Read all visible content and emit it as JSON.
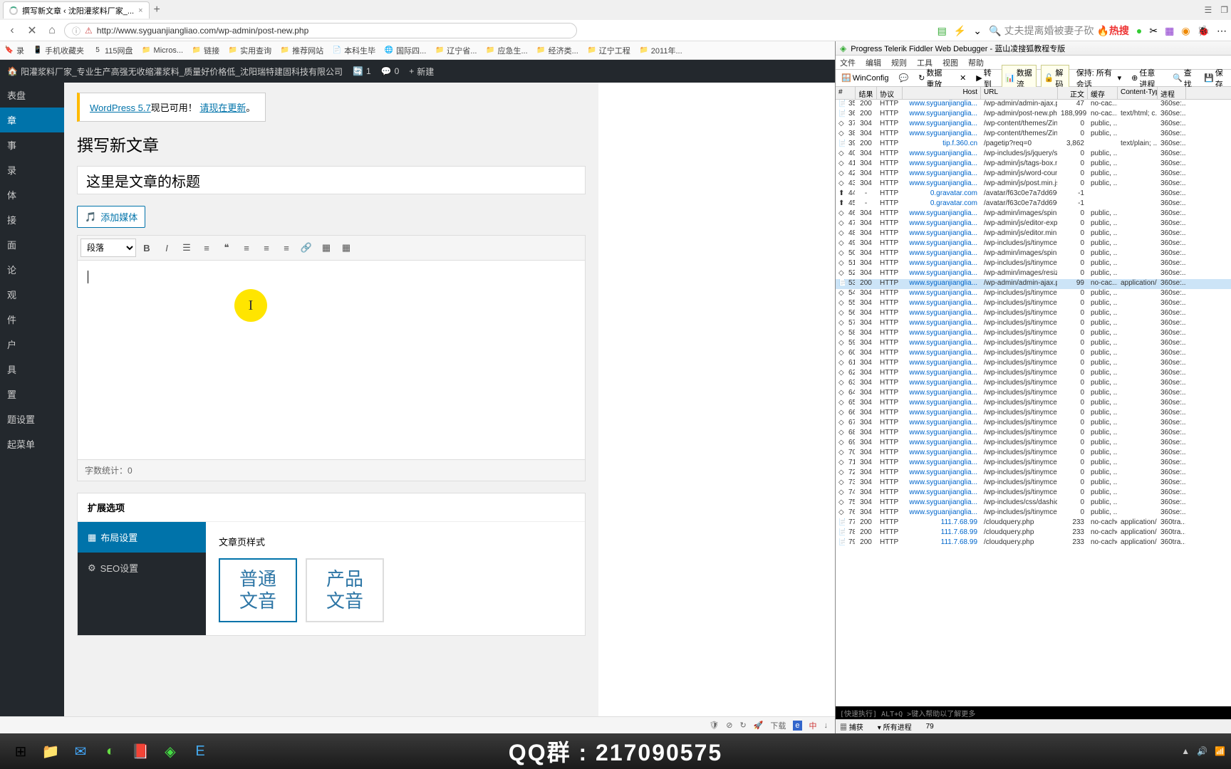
{
  "browser": {
    "tab_title": "撰写新文章 ‹ 沈阳灌浆料厂家_...",
    "url": "http://www.syguanjiangliao.com/wp-admin/post-new.php",
    "search_placeholder": "丈夫提离婚被妻子砍",
    "hot_label": "🔥热搜"
  },
  "bookmarks": [
    "录",
    "手机收藏夹",
    "115网盘",
    "Micros...",
    "链接",
    "实用查询",
    "推荐网站",
    "本科生毕",
    "国际四...",
    "辽宁省...",
    "应急生...",
    "经济类...",
    "辽宁工程",
    "2011年..."
  ],
  "wp_adminbar": {
    "site": "阳灌浆料厂家_专业生产高强无收缩灌浆料_质量好价格低_沈阳瑞特建固科技有限公司",
    "comments_pending": "1",
    "comments_new": "0",
    "new_label": "新建"
  },
  "wp_sidebar": [
    "表盘",
    "章",
    "事",
    "录",
    "体",
    "接",
    "面",
    "论",
    "观",
    "件",
    "户",
    "具",
    "置",
    "题设置",
    "起菜单"
  ],
  "editor": {
    "notice_pre": "WordPress 5.7",
    "notice_mid": "现已可用！",
    "notice_link": "请现在更新",
    "page_heading": "撰写新文章",
    "title_value": "这里是文章的标题",
    "media_btn": "添加媒体",
    "format_select": "段落",
    "word_count_label": "字数统计：",
    "word_count_value": "0",
    "ext_header": "扩展选项",
    "ext_tab_layout": "布局设置",
    "ext_tab_seo": "SEO设置",
    "ext_content_heading": "文章页样式",
    "style_card_1": "普通\n文音",
    "style_card_2": "产品\n文音"
  },
  "fiddler": {
    "title": "Progress Telerik Fiddler Web Debugger - 蓝山凌搜狐教程专版",
    "menus": [
      "文件",
      "编辑",
      "规则",
      "工具",
      "视图",
      "帮助"
    ],
    "toolbar": {
      "winconfig": "WinConfig",
      "replay": "数据重放",
      "go": "转到",
      "stream": "数据流",
      "decode": "解码",
      "keep": "保持: 所有会话",
      "process": "任意进程",
      "find": "查找",
      "save": "保存"
    },
    "headers": {
      "num": "#",
      "result": "结果",
      "protocol": "协议",
      "host": "Host",
      "url": "URL",
      "body": "正文",
      "cache": "缓存",
      "ct": "Content-Type",
      "process": "进程"
    },
    "cmd": "[快速执行] ALT+Q >键入帮助以了解更多",
    "status": {
      "capture": "捕获",
      "all": "所有进程",
      "count": "79"
    },
    "sessions": [
      {
        "i": "📄",
        "n": "35",
        "r": "200",
        "p": "HTTP",
        "h": "www.syguanjianglia...",
        "u": "/wp-admin/admin-ajax.php",
        "b": "47",
        "c": "no-cac...",
        "t": "",
        "pr": "360se:..."
      },
      {
        "i": "📄",
        "n": "36",
        "r": "200",
        "p": "HTTP",
        "h": "www.syguanjianglia...",
        "u": "/wp-admin/post-new.php",
        "b": "188,999",
        "c": "no-cac...",
        "t": "text/html; c...",
        "pr": "360se:..."
      },
      {
        "i": "◇",
        "n": "37",
        "r": "304",
        "p": "HTTP",
        "h": "www.syguanjianglia...",
        "u": "/wp-content/themes/Zing/...",
        "b": "0",
        "c": "public, ...",
        "t": "",
        "pr": "360se:..."
      },
      {
        "i": "◇",
        "n": "38",
        "r": "304",
        "p": "HTTP",
        "h": "www.syguanjianglia...",
        "u": "/wp-content/themes/Zing/...",
        "b": "0",
        "c": "public, ...",
        "t": "",
        "pr": "360se:..."
      },
      {
        "i": "📄",
        "n": "39",
        "r": "200",
        "p": "HTTP",
        "h": "tip.f.360.cn",
        "u": "/pagetip?req=0",
        "b": "3,862",
        "c": "",
        "t": "text/plain; ...",
        "pr": "360se:..."
      },
      {
        "i": "◇",
        "n": "40",
        "r": "304",
        "p": "HTTP",
        "h": "www.syguanjianglia...",
        "u": "/wp-includes/js/jquery/su...",
        "b": "0",
        "c": "public, ...",
        "t": "",
        "pr": "360se:..."
      },
      {
        "i": "◇",
        "n": "41",
        "r": "304",
        "p": "HTTP",
        "h": "www.syguanjianglia...",
        "u": "/wp-admin/js/tags-box.mi...",
        "b": "0",
        "c": "public, ...",
        "t": "",
        "pr": "360se:..."
      },
      {
        "i": "◇",
        "n": "42",
        "r": "304",
        "p": "HTTP",
        "h": "www.syguanjianglia...",
        "u": "/wp-admin/js/word-count...",
        "b": "0",
        "c": "public, ...",
        "t": "",
        "pr": "360se:..."
      },
      {
        "i": "◇",
        "n": "43",
        "r": "304",
        "p": "HTTP",
        "h": "www.syguanjianglia...",
        "u": "/wp-admin/js/post.min.js",
        "b": "0",
        "c": "public, ...",
        "t": "",
        "pr": "360se:..."
      },
      {
        "i": "⬆",
        "n": "44",
        "r": "-",
        "p": "HTTP",
        "h": "0.gravatar.com",
        "u": "/avatar/f63c0e7a7dd690...",
        "b": "-1",
        "c": "",
        "t": "",
        "pr": "360se:..."
      },
      {
        "i": "⬆",
        "n": "45",
        "r": "-",
        "p": "HTTP",
        "h": "0.gravatar.com",
        "u": "/avatar/f63c0e7a7dd690...",
        "b": "-1",
        "c": "",
        "t": "",
        "pr": "360se:..."
      },
      {
        "i": "◇",
        "n": "46",
        "r": "304",
        "p": "HTTP",
        "h": "www.syguanjianglia...",
        "u": "/wp-admin/images/spinner...",
        "b": "0",
        "c": "public, ...",
        "t": "",
        "pr": "360se:..."
      },
      {
        "i": "◇",
        "n": "47",
        "r": "304",
        "p": "HTTP",
        "h": "www.syguanjianglia...",
        "u": "/wp-admin/js/editor-expa...",
        "b": "0",
        "c": "public, ...",
        "t": "",
        "pr": "360se:..."
      },
      {
        "i": "◇",
        "n": "48",
        "r": "304",
        "p": "HTTP",
        "h": "www.syguanjianglia...",
        "u": "/wp-admin/js/editor.min.js",
        "b": "0",
        "c": "public, ...",
        "t": "",
        "pr": "360se:..."
      },
      {
        "i": "◇",
        "n": "49",
        "r": "304",
        "p": "HTTP",
        "h": "www.syguanjianglia...",
        "u": "/wp-includes/js/tinymce/pl...",
        "b": "0",
        "c": "public, ...",
        "t": "",
        "pr": "360se:..."
      },
      {
        "i": "◇",
        "n": "50",
        "r": "304",
        "p": "HTTP",
        "h": "www.syguanjianglia...",
        "u": "/wp-admin/images/spinner...",
        "b": "0",
        "c": "public, ...",
        "t": "",
        "pr": "360se:..."
      },
      {
        "i": "◇",
        "n": "51",
        "r": "304",
        "p": "HTTP",
        "h": "www.syguanjianglia...",
        "u": "/wp-includes/js/tinymce/pl...",
        "b": "0",
        "c": "public, ...",
        "t": "",
        "pr": "360se:..."
      },
      {
        "i": "◇",
        "n": "52",
        "r": "304",
        "p": "HTTP",
        "h": "www.syguanjianglia...",
        "u": "/wp-admin/images/resize.gif",
        "b": "0",
        "c": "public, ...",
        "t": "",
        "pr": "360se:..."
      },
      {
        "i": "📄",
        "n": "53",
        "r": "200",
        "p": "HTTP",
        "h": "www.syguanjianglia...",
        "u": "/wp-admin/admin-ajax.php",
        "b": "99",
        "c": "no-cac...",
        "t": "application/...",
        "pr": "360se:...",
        "sel": true
      },
      {
        "i": "◇",
        "n": "54",
        "r": "304",
        "p": "HTTP",
        "h": "www.syguanjianglia...",
        "u": "/wp-includes/js/tinymce/t...",
        "b": "0",
        "c": "public, ...",
        "t": "",
        "pr": "360se:..."
      },
      {
        "i": "◇",
        "n": "55",
        "r": "304",
        "p": "HTTP",
        "h": "www.syguanjianglia...",
        "u": "/wp-includes/js/tinymce/pl...",
        "b": "0",
        "c": "public, ...",
        "t": "",
        "pr": "360se:..."
      },
      {
        "i": "◇",
        "n": "56",
        "r": "304",
        "p": "HTTP",
        "h": "www.syguanjianglia...",
        "u": "/wp-includes/js/tinymce/pl...",
        "b": "0",
        "c": "public, ...",
        "t": "",
        "pr": "360se:..."
      },
      {
        "i": "◇",
        "n": "57",
        "r": "304",
        "p": "HTTP",
        "h": "www.syguanjianglia...",
        "u": "/wp-includes/js/tinymce/pl...",
        "b": "0",
        "c": "public, ...",
        "t": "",
        "pr": "360se:..."
      },
      {
        "i": "◇",
        "n": "58",
        "r": "304",
        "p": "HTTP",
        "h": "www.syguanjianglia...",
        "u": "/wp-includes/js/tinymce/pl...",
        "b": "0",
        "c": "public, ...",
        "t": "",
        "pr": "360se:..."
      },
      {
        "i": "◇",
        "n": "59",
        "r": "304",
        "p": "HTTP",
        "h": "www.syguanjianglia...",
        "u": "/wp-includes/js/tinymce/pl...",
        "b": "0",
        "c": "public, ...",
        "t": "",
        "pr": "360se:..."
      },
      {
        "i": "◇",
        "n": "60",
        "r": "304",
        "p": "HTTP",
        "h": "www.syguanjianglia...",
        "u": "/wp-includes/js/tinymce/pl...",
        "b": "0",
        "c": "public, ...",
        "t": "",
        "pr": "360se:..."
      },
      {
        "i": "◇",
        "n": "61",
        "r": "304",
        "p": "HTTP",
        "h": "www.syguanjianglia...",
        "u": "/wp-includes/js/tinymce/pl...",
        "b": "0",
        "c": "public, ...",
        "t": "",
        "pr": "360se:..."
      },
      {
        "i": "◇",
        "n": "62",
        "r": "304",
        "p": "HTTP",
        "h": "www.syguanjianglia...",
        "u": "/wp-includes/js/tinymce/pl...",
        "b": "0",
        "c": "public, ...",
        "t": "",
        "pr": "360se:..."
      },
      {
        "i": "◇",
        "n": "63",
        "r": "304",
        "p": "HTTP",
        "h": "www.syguanjianglia...",
        "u": "/wp-includes/js/tinymce/pl...",
        "b": "0",
        "c": "public, ...",
        "t": "",
        "pr": "360se:..."
      },
      {
        "i": "◇",
        "n": "64",
        "r": "304",
        "p": "HTTP",
        "h": "www.syguanjianglia...",
        "u": "/wp-includes/js/tinymce/pl...",
        "b": "0",
        "c": "public, ...",
        "t": "",
        "pr": "360se:..."
      },
      {
        "i": "◇",
        "n": "65",
        "r": "304",
        "p": "HTTP",
        "h": "www.syguanjianglia...",
        "u": "/wp-includes/js/tinymce/pl...",
        "b": "0",
        "c": "public, ...",
        "t": "",
        "pr": "360se:..."
      },
      {
        "i": "◇",
        "n": "66",
        "r": "304",
        "p": "HTTP",
        "h": "www.syguanjianglia...",
        "u": "/wp-includes/js/tinymce/pl...",
        "b": "0",
        "c": "public, ...",
        "t": "",
        "pr": "360se:..."
      },
      {
        "i": "◇",
        "n": "67",
        "r": "304",
        "p": "HTTP",
        "h": "www.syguanjianglia...",
        "u": "/wp-includes/js/tinymce/pl...",
        "b": "0",
        "c": "public, ...",
        "t": "",
        "pr": "360se:..."
      },
      {
        "i": "◇",
        "n": "68",
        "r": "304",
        "p": "HTTP",
        "h": "www.syguanjianglia...",
        "u": "/wp-includes/js/tinymce/pl...",
        "b": "0",
        "c": "public, ...",
        "t": "",
        "pr": "360se:..."
      },
      {
        "i": "◇",
        "n": "69",
        "r": "304",
        "p": "HTTP",
        "h": "www.syguanjianglia...",
        "u": "/wp-includes/js/tinymce/pl...",
        "b": "0",
        "c": "public, ...",
        "t": "",
        "pr": "360se:..."
      },
      {
        "i": "◇",
        "n": "70",
        "r": "304",
        "p": "HTTP",
        "h": "www.syguanjianglia...",
        "u": "/wp-includes/js/tinymce/th...",
        "b": "0",
        "c": "public, ...",
        "t": "",
        "pr": "360se:..."
      },
      {
        "i": "◇",
        "n": "71",
        "r": "304",
        "p": "HTTP",
        "h": "www.syguanjianglia...",
        "u": "/wp-includes/js/tinymce/pl...",
        "b": "0",
        "c": "public, ...",
        "t": "",
        "pr": "360se:..."
      },
      {
        "i": "◇",
        "n": "72",
        "r": "304",
        "p": "HTTP",
        "h": "www.syguanjianglia...",
        "u": "/wp-includes/js/tinymce/pl...",
        "b": "0",
        "c": "public, ...",
        "t": "",
        "pr": "360se:..."
      },
      {
        "i": "◇",
        "n": "73",
        "r": "304",
        "p": "HTTP",
        "h": "www.syguanjianglia...",
        "u": "/wp-includes/js/tinymce/pl...",
        "b": "0",
        "c": "public, ...",
        "t": "",
        "pr": "360se:..."
      },
      {
        "i": "◇",
        "n": "74",
        "r": "304",
        "p": "HTTP",
        "h": "www.syguanjianglia...",
        "u": "/wp-includes/js/tinymce/pl...",
        "b": "0",
        "c": "public, ...",
        "t": "",
        "pr": "360se:..."
      },
      {
        "i": "◇",
        "n": "75",
        "r": "304",
        "p": "HTTP",
        "h": "www.syguanjianglia...",
        "u": "/wp-includes/css/dashicon...",
        "b": "0",
        "c": "public, ...",
        "t": "",
        "pr": "360se:..."
      },
      {
        "i": "◇",
        "n": "76",
        "r": "304",
        "p": "HTTP",
        "h": "www.syguanjianglia...",
        "u": "/wp-includes/js/tinymce/s...",
        "b": "0",
        "c": "public, ...",
        "t": "",
        "pr": "360se:..."
      },
      {
        "i": "📄",
        "n": "77",
        "r": "200",
        "p": "HTTP",
        "h": "111.7.68.99",
        "u": "/cloudquery.php",
        "b": "233",
        "c": "no-cache",
        "t": "application/...",
        "pr": "360tra..."
      },
      {
        "i": "📄",
        "n": "78",
        "r": "200",
        "p": "HTTP",
        "h": "111.7.68.99",
        "u": "/cloudquery.php",
        "b": "233",
        "c": "no-cache",
        "t": "application/...",
        "pr": "360tra..."
      },
      {
        "i": "📄",
        "n": "79",
        "r": "200",
        "p": "HTTP",
        "h": "111.7.68.99",
        "u": "/cloudquery.php",
        "b": "233",
        "c": "no-cache",
        "t": "application/...",
        "pr": "360tra..."
      }
    ]
  },
  "qq": "QQ群 : 217090575",
  "browser_status": {
    "download": "下载",
    "speed": "↓"
  }
}
